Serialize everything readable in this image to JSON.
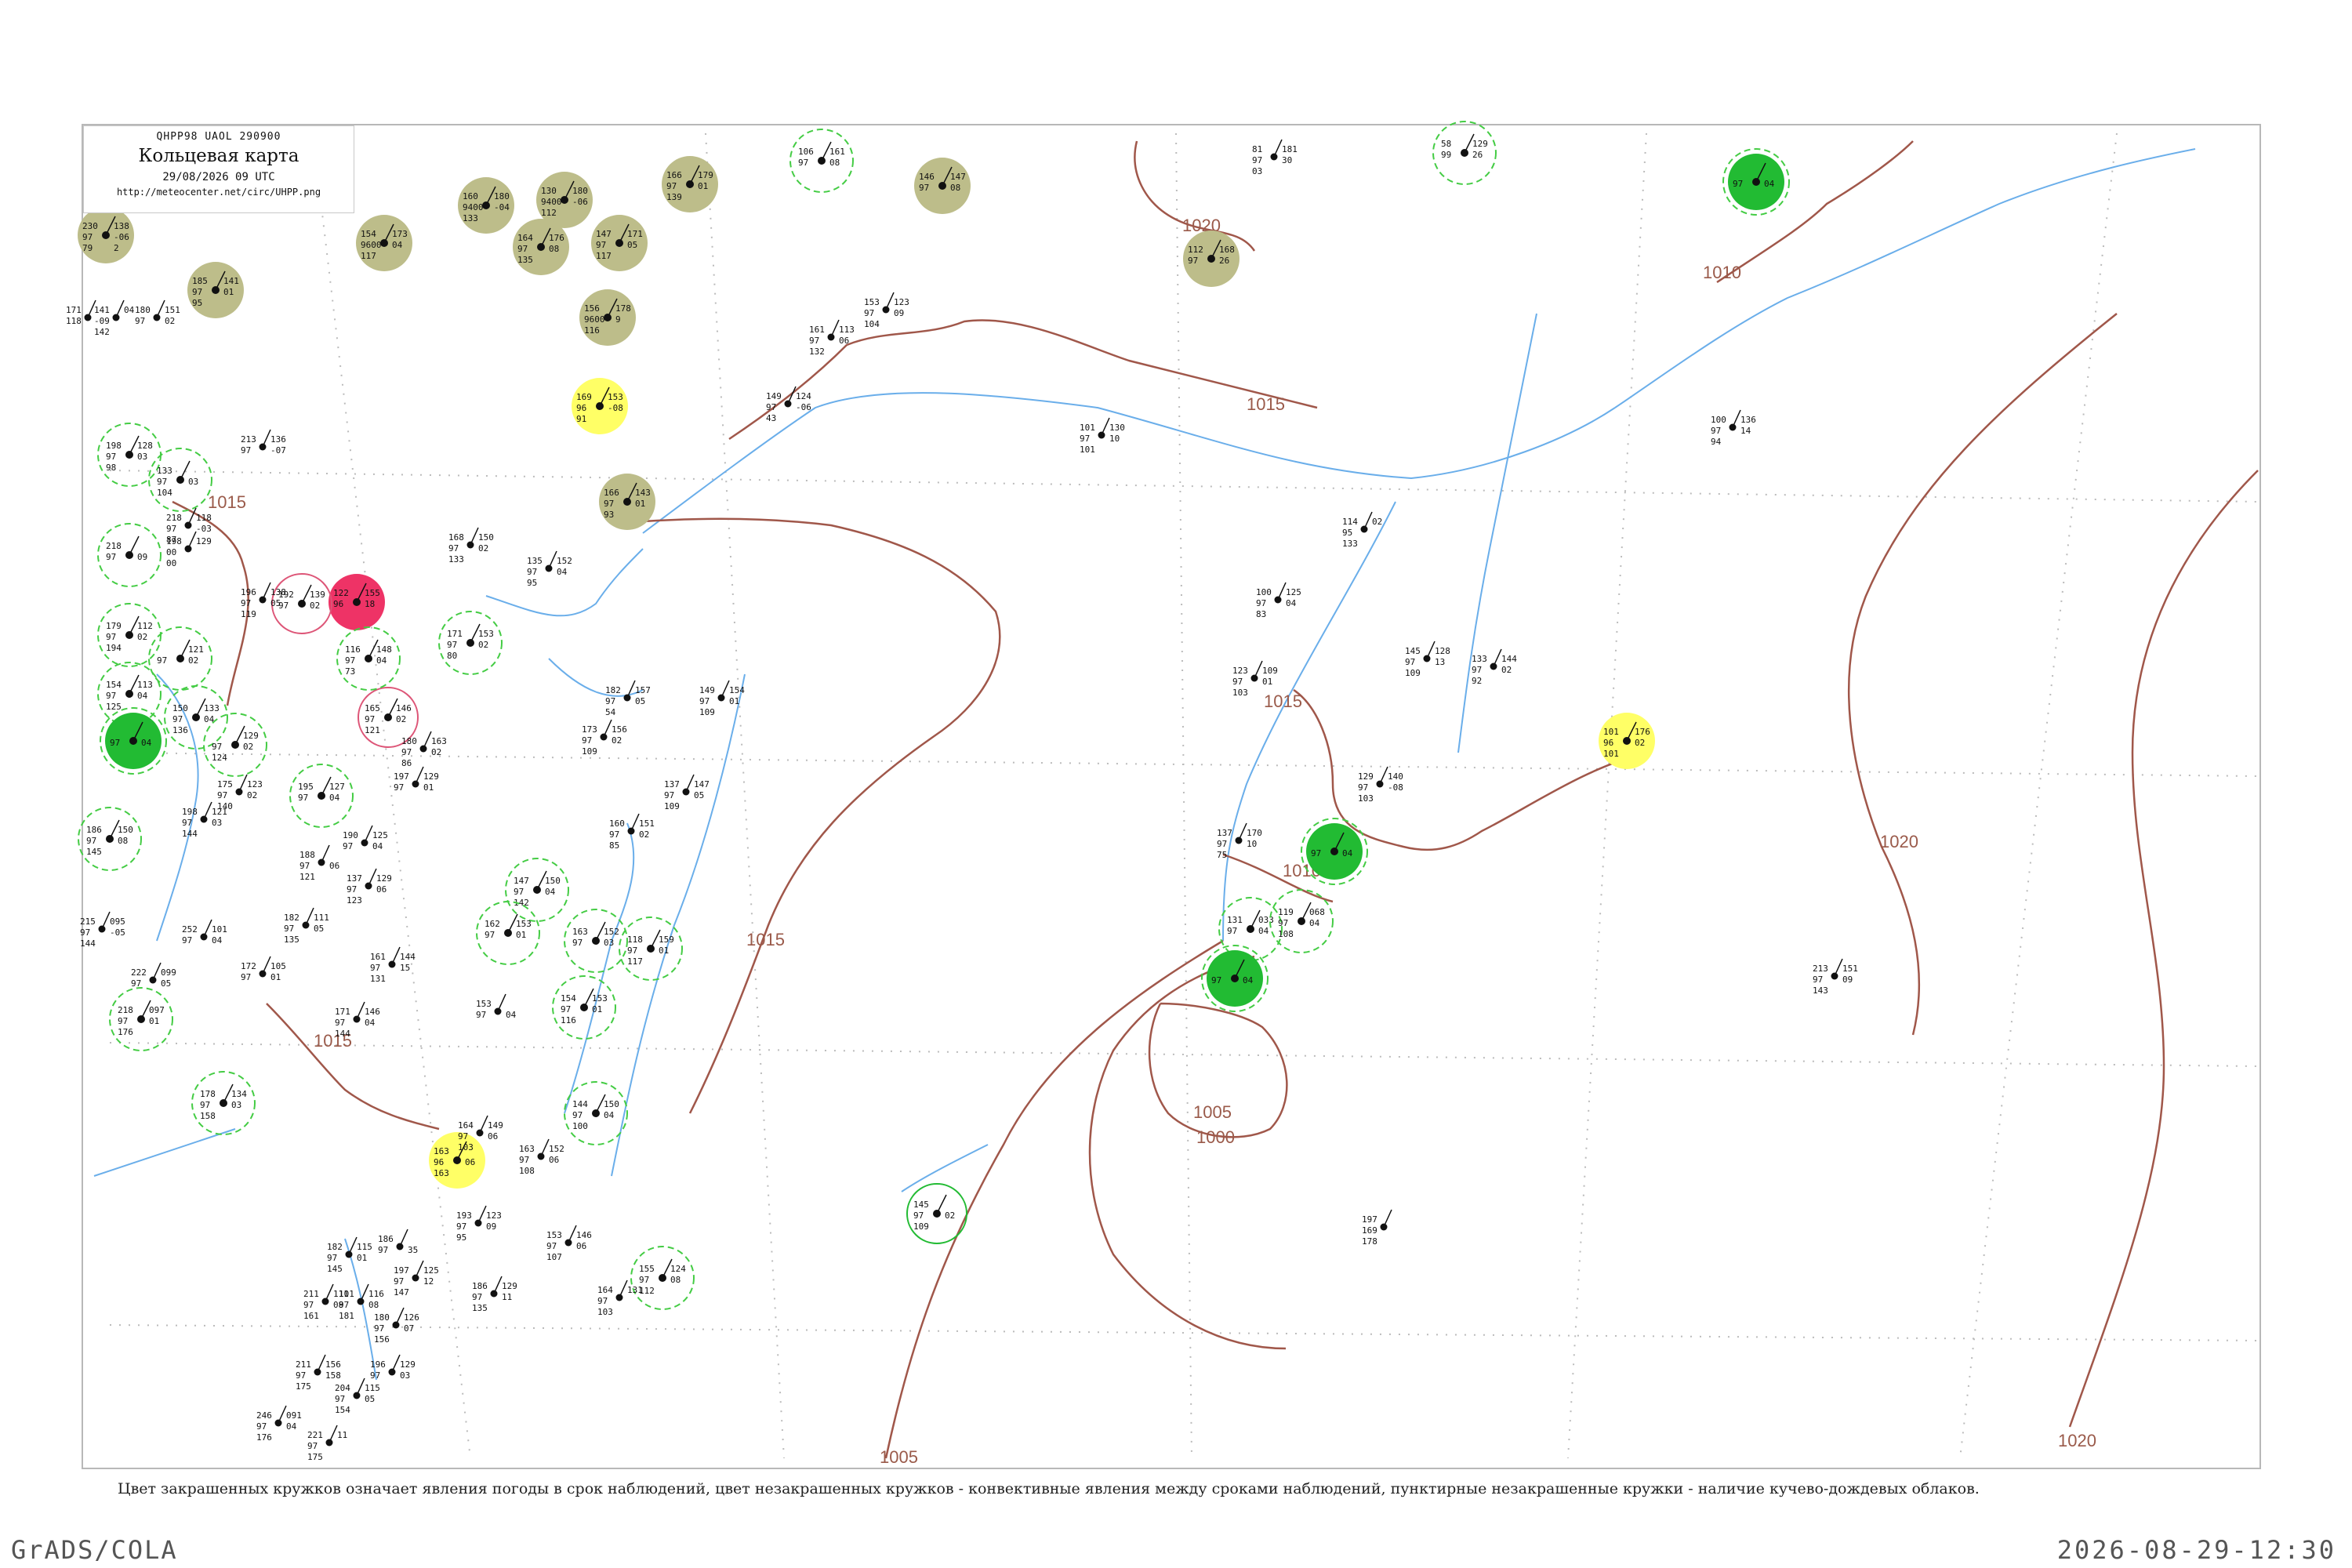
{
  "header": {
    "code": "QHPP98  UAOL  290900",
    "title": "Кольцевая карта",
    "datetime": "29/08/2026 09 UTC",
    "url": "http://meteocenter.net/circ/UHPP.png"
  },
  "isobars": [
    {
      "label": "1020"
    },
    {
      "label": "1015"
    },
    {
      "label": "1015"
    },
    {
      "label": "1015"
    },
    {
      "label": "1015"
    },
    {
      "label": "1015"
    },
    {
      "label": "1010"
    },
    {
      "label": "1010"
    },
    {
      "label": "1005"
    },
    {
      "label": "1000"
    },
    {
      "label": "1005"
    },
    {
      "label": "1020"
    },
    {
      "label": "1020"
    }
  ],
  "colors": {
    "isobar": "#a0574a",
    "river": "#6aaeea",
    "coast": "#6aaeea",
    "olive": "#bdbd8a",
    "yellow": "#ffff66",
    "green": "#22bb33",
    "red": "#ee3366",
    "dashed_green": "#44cc44",
    "pink_ring": "#dd5577"
  },
  "stations": [
    {
      "kind": "olive",
      "values": [
        "230",
        "97",
        "79",
        "138",
        "-06",
        "2"
      ]
    },
    {
      "kind": "olive",
      "values": [
        "185",
        "97",
        "95",
        "141",
        "01"
      ]
    },
    {
      "kind": "olive",
      "values": [
        "160",
        "9400",
        "133",
        "180",
        "-04"
      ]
    },
    {
      "kind": "olive",
      "values": [
        "130",
        "9400",
        "112",
        "180",
        "-06"
      ]
    },
    {
      "kind": "olive",
      "values": [
        "154",
        "9600",
        "117",
        "173",
        "04"
      ]
    },
    {
      "kind": "olive",
      "values": [
        "164",
        "97",
        "135",
        "176",
        "08"
      ]
    },
    {
      "kind": "olive",
      "values": [
        "147",
        "97",
        "117",
        "171",
        "05"
      ]
    },
    {
      "kind": "olive",
      "values": [
        "156",
        "9600",
        "116",
        "178",
        "9"
      ]
    },
    {
      "kind": "olive",
      "values": [
        "166",
        "97",
        "139",
        "179",
        "01"
      ]
    },
    {
      "kind": "olive",
      "values": [
        "146",
        "97",
        "",
        "147",
        "08"
      ]
    },
    {
      "kind": "olive",
      "values": [
        "112",
        "97",
        "",
        "168",
        "26"
      ]
    },
    {
      "kind": "olive",
      "values": [
        "166",
        "97",
        "93",
        "143",
        "01"
      ]
    },
    {
      "kind": "dgreen",
      "values": [
        "106",
        "97",
        "",
        "161",
        "08"
      ]
    },
    {
      "kind": "dgreen",
      "values": [
        "58",
        "99",
        "",
        "129",
        "26"
      ]
    },
    {
      "kind": "green",
      "values": [
        "",
        "97",
        "",
        "",
        "04"
      ]
    },
    {
      "kind": "yellow",
      "values": [
        "169",
        "96",
        "91",
        "153",
        "-08"
      ]
    },
    {
      "kind": "red",
      "values": [
        "122",
        "96",
        "",
        "155",
        "18"
      ]
    },
    {
      "kind": "pink",
      "values": [
        "192",
        "97",
        "",
        "139",
        "02"
      ]
    },
    {
      "kind": "pink",
      "values": [
        "165",
        "97",
        "121",
        "146",
        "02"
      ]
    },
    {
      "kind": "dgreen",
      "values": [
        "198",
        "97",
        "98",
        "128",
        "03"
      ]
    },
    {
      "kind": "dgreen",
      "values": [
        "133",
        "97",
        "104",
        "",
        "03"
      ]
    },
    {
      "kind": "dgreen",
      "values": [
        "218",
        "97",
        "",
        "",
        "09"
      ]
    },
    {
      "kind": "dgreen",
      "values": [
        "179",
        "97",
        "194",
        "112",
        "02"
      ]
    },
    {
      "kind": "dgreen",
      "values": [
        "",
        "97",
        "",
        "121",
        "02"
      ]
    },
    {
      "kind": "dgreen",
      "values": [
        "154",
        "97",
        "125",
        "113",
        "04"
      ]
    },
    {
      "kind": "green",
      "values": [
        "",
        "97",
        "",
        "",
        "04"
      ]
    },
    {
      "kind": "dgreen",
      "values": [
        "150",
        "97",
        "136",
        "133",
        "04"
      ]
    },
    {
      "kind": "dgreen",
      "values": [
        "",
        "97",
        "124",
        "129",
        "02"
      ]
    },
    {
      "kind": "dgreen",
      "values": [
        "186",
        "97",
        "145",
        "150",
        "08"
      ]
    },
    {
      "kind": "dgreen",
      "values": [
        "195",
        "97",
        "",
        "127",
        "04"
      ]
    },
    {
      "kind": "dgreen",
      "values": [
        "218",
        "97",
        "176",
        "097",
        "01"
      ]
    },
    {
      "kind": "dgreen",
      "values": [
        "178",
        "97",
        "158",
        "134",
        "03"
      ]
    },
    {
      "kind": "dgreen",
      "values": [
        "171",
        "97",
        "80",
        "153",
        "02"
      ]
    },
    {
      "kind": "dgreen",
      "values": [
        "116",
        "97",
        "73",
        "148",
        "04"
      ]
    },
    {
      "kind": "dgreen",
      "values": [
        "147",
        "97",
        "142",
        "150",
        "04"
      ]
    },
    {
      "kind": "dgreen",
      "values": [
        "162",
        "97",
        "",
        "153",
        "01"
      ]
    },
    {
      "kind": "dgreen",
      "values": [
        "163",
        "97",
        "",
        "152",
        "03"
      ]
    },
    {
      "kind": "dgreen",
      "values": [
        "118",
        "97",
        "117",
        "159",
        "01"
      ]
    },
    {
      "kind": "dgreen",
      "values": [
        "154",
        "97",
        "116",
        "153",
        "01"
      ]
    },
    {
      "kind": "dgreen",
      "values": [
        "144",
        "97",
        "100",
        "150",
        "04"
      ]
    },
    {
      "kind": "yellow",
      "values": [
        "163",
        "96",
        "163",
        "",
        "06"
      ]
    },
    {
      "kind": "dgreen",
      "values": [
        "155",
        "97",
        "112",
        "124",
        "08"
      ]
    },
    {
      "kind": "ring",
      "values": [
        "145",
        "97",
        "109",
        "",
        "02"
      ]
    },
    {
      "kind": "green",
      "values": [
        "",
        "97",
        "",
        "",
        "04"
      ]
    },
    {
      "kind": "dgreen",
      "values": [
        "131",
        "97",
        "",
        "033",
        "04"
      ]
    },
    {
      "kind": "dgreen",
      "values": [
        "119",
        "97",
        "108",
        "068",
        "04"
      ]
    },
    {
      "kind": "green",
      "values": [
        "",
        "97",
        "",
        "",
        "04"
      ]
    },
    {
      "kind": "yellow",
      "values": [
        "101",
        "96",
        "101",
        "176",
        "02"
      ]
    }
  ],
  "plain_stations": [
    {
      "values": [
        "171",
        "118"
      ]
    },
    {
      "values": [
        "141",
        "-09",
        "142",
        "04"
      ]
    },
    {
      "values": [
        "180",
        "97",
        "",
        "151",
        "02"
      ]
    },
    {
      "values": [
        "213",
        "97",
        "",
        "136",
        "-07"
      ]
    },
    {
      "values": [
        "218",
        "97",
        "87",
        "118",
        "-03"
      ]
    },
    {
      "values": [
        "198",
        "00",
        "00",
        "129"
      ]
    },
    {
      "values": [
        "196",
        "97",
        "119",
        "138",
        "05"
      ]
    },
    {
      "values": [
        "168",
        "97",
        "133",
        "150",
        "02"
      ]
    },
    {
      "values": [
        "135",
        "97",
        "95",
        "152",
        "04"
      ]
    },
    {
      "values": [
        "182",
        "97",
        "54",
        "157",
        "05"
      ]
    },
    {
      "values": [
        "149",
        "97",
        "109",
        "154",
        "01"
      ]
    },
    {
      "values": [
        "173",
        "97",
        "109",
        "156",
        "02"
      ]
    },
    {
      "values": [
        "137",
        "97",
        "109",
        "147",
        "05"
      ]
    },
    {
      "values": [
        "160",
        "97",
        "85",
        "151",
        "02"
      ]
    },
    {
      "values": [
        "149",
        "97",
        "43",
        "124",
        "-06"
      ]
    },
    {
      "values": [
        "161",
        "97",
        "132",
        "113",
        "06"
      ]
    },
    {
      "values": [
        "153",
        "97",
        "104",
        "123",
        "09"
      ]
    },
    {
      "values": [
        "101",
        "97",
        "101",
        "130",
        "10"
      ]
    },
    {
      "values": [
        "81",
        "97",
        "03",
        "181",
        "30"
      ]
    },
    {
      "values": [
        "100",
        "97",
        "94",
        "136",
        "14"
      ]
    },
    {
      "values": [
        "114",
        "95",
        "133",
        "02"
      ]
    },
    {
      "values": [
        "100",
        "97",
        "83",
        "125",
        "04"
      ]
    },
    {
      "values": [
        "123",
        "97",
        "103",
        "109",
        "01"
      ]
    },
    {
      "values": [
        "145",
        "97",
        "109",
        "128",
        "13"
      ]
    },
    {
      "values": [
        "133",
        "97",
        "92",
        "144",
        "02"
      ]
    },
    {
      "values": [
        "129",
        "97",
        "103",
        "140",
        "-08"
      ]
    },
    {
      "values": [
        "137",
        "97",
        "75",
        "170",
        "10"
      ]
    },
    {
      "values": [
        "213",
        "97",
        "143",
        "151",
        "09"
      ]
    },
    {
      "values": [
        "197",
        "169",
        "178"
      ]
    },
    {
      "values": [
        "215",
        "97",
        "144",
        "095",
        "-05"
      ]
    },
    {
      "values": [
        "252",
        "97",
        "",
        "101",
        "04"
      ]
    },
    {
      "values": [
        "222",
        "97",
        "",
        "099",
        "05"
      ]
    },
    {
      "values": [
        "172",
        "97",
        "",
        "105",
        "01"
      ]
    },
    {
      "values": [
        "175",
        "97",
        "140",
        "123",
        "02"
      ]
    },
    {
      "values": [
        "198",
        "97",
        "144",
        "121",
        "03"
      ]
    },
    {
      "values": [
        "188",
        "97",
        "121",
        "",
        "06"
      ]
    },
    {
      "values": [
        "182",
        "97",
        "135",
        "111",
        "05"
      ]
    },
    {
      "values": [
        "190",
        "97",
        "",
        "125",
        "04"
      ]
    },
    {
      "values": [
        "137",
        "97",
        "123",
        "129",
        "06"
      ]
    },
    {
      "values": [
        "161",
        "97",
        "131",
        "144",
        "15"
      ]
    },
    {
      "values": [
        "171",
        "97",
        "144",
        "146",
        "04"
      ]
    },
    {
      "values": [
        "180",
        "97",
        "86",
        "163",
        "02"
      ]
    },
    {
      "values": [
        "197",
        "97",
        "",
        "129",
        "01"
      ]
    },
    {
      "values": [
        "153",
        "97",
        "",
        "",
        "04"
      ]
    },
    {
      "values": [
        "164",
        "97",
        "103",
        "149",
        "06"
      ]
    },
    {
      "values": [
        "163",
        "97",
        "108",
        "152",
        "06"
      ]
    },
    {
      "values": [
        "193",
        "97",
        "95",
        "123",
        "09"
      ]
    },
    {
      "values": [
        "186",
        "97",
        "135",
        "129",
        "11"
      ]
    },
    {
      "values": [
        "153",
        "97",
        "107",
        "146",
        "06"
      ]
    },
    {
      "values": [
        "164",
        "97",
        "103",
        "131"
      ]
    },
    {
      "values": [
        "182",
        "97",
        "145",
        "115",
        "01"
      ]
    },
    {
      "values": [
        "186",
        "97",
        "",
        "",
        "35"
      ]
    },
    {
      "values": [
        "197",
        "97",
        "147",
        "125",
        "12"
      ]
    },
    {
      "values": [
        "211",
        "97",
        "161",
        "111",
        "08"
      ]
    },
    {
      "values": [
        "101",
        "97",
        "181",
        "116",
        "08"
      ]
    },
    {
      "values": [
        "180",
        "97",
        "156",
        "126",
        "07"
      ]
    },
    {
      "values": [
        "211",
        "97",
        "175",
        "156",
        "158"
      ]
    },
    {
      "values": [
        "246",
        "97",
        "176",
        "091",
        "04"
      ]
    },
    {
      "values": [
        "221",
        "97",
        "175",
        "11"
      ]
    },
    {
      "values": [
        "204",
        "97",
        "154",
        "115",
        "05"
      ]
    },
    {
      "values": [
        "196",
        "97",
        "",
        "129",
        "03"
      ]
    }
  ],
  "footnote": "Цвет закрашенных кружков означает явления погоды в срок наблюдений, цвет незакрашенных кружков - конвективные явления между сроками наблюдений, пунктирные незакрашенные кружки - наличие кучево-дождевых облаков.",
  "credit": "GrADS/COLA",
  "timestamp": "2026-08-29-12:30"
}
